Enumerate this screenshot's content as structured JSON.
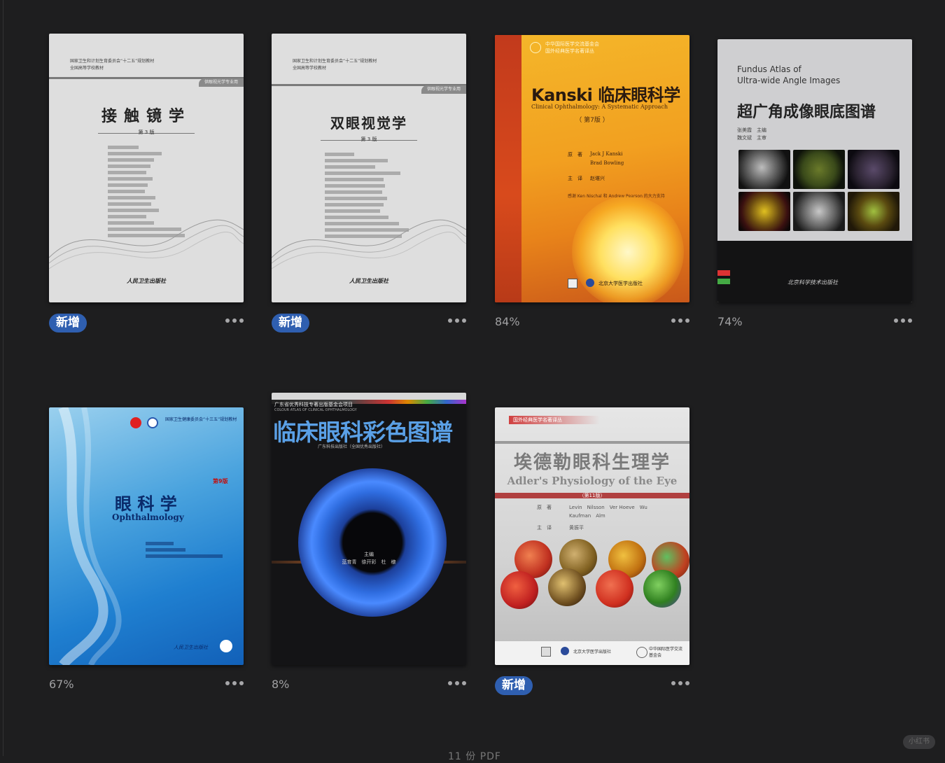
{
  "books": [
    {
      "id": "b1",
      "status_badge": "新增",
      "progress": "",
      "cover": {
        "title": "接触镜学",
        "edition": "第 3 版",
        "series": "供眼视光学专业用",
        "publisher": "人民卫生出版社",
        "header1": "国家卫生和计划生育委员会“十二五”规划教材",
        "header2": "全国高等学校教材"
      }
    },
    {
      "id": "b2",
      "status_badge": "新增",
      "progress": "",
      "cover": {
        "title": "双眼视觉学",
        "edition": "第 3 版",
        "series": "供眼视光学专业用",
        "publisher": "人民卫生出版社",
        "header1": "国家卫生和计划生育委员会“十二五”规划教材",
        "header2": "全国高等学校教材"
      }
    },
    {
      "id": "b3",
      "status_badge": "",
      "progress": "84%",
      "cover": {
        "top_line1": "中华国际医学交流基金会",
        "top_line2": "国外经典医学名著译丛",
        "title": "Kanski 临床眼科学",
        "subtitle": "Clinical Ophthalmology: A Systematic Approach",
        "edition": "（ 第7版 ）",
        "author_label": "原　著",
        "authors1": "Jack J Kanski",
        "authors2": "Brad Bowling",
        "translator_label": "主　译",
        "translator": "赵堪兴",
        "thanks": "感谢 Ken Nischal 和 Andrew Pearson 的大力支持",
        "publisher": "北京大学医学出版社"
      }
    },
    {
      "id": "b4",
      "status_badge": "",
      "progress": "74%",
      "cover": {
        "en_title1": "Fundus Atlas of",
        "en_title2": "Ultra-wide Angle Images",
        "title": "超广角成像眼底图谱",
        "editor1": "张美霞　主编",
        "editor2": "魏文斌　主审",
        "publisher": "北京科学技术出版社"
      }
    },
    {
      "id": "b5",
      "status_badge": "",
      "progress": "67%",
      "cover": {
        "title": "眼 科 学",
        "en_title": "Ophthalmology",
        "edition": "第9版",
        "header": "国家卫生健康委员会“十三五”规划教材",
        "publisher": "人民卫生出版社"
      }
    },
    {
      "id": "b6",
      "status_badge": "",
      "progress": "8%",
      "cover": {
        "top_line": "广东省优秀科技专著出版基金会项目",
        "en_line": "COLOUR ATLAS OF CLINICAL OPHTHALMOLOGY",
        "title": "临床眼科彩色图谱",
        "sub_line": "广东科技出版社（全国优秀出版社）",
        "center_label": "主编",
        "center_names": "蓝育青　徐开彩　杜　棣"
      }
    },
    {
      "id": "b7",
      "status_badge": "新增",
      "progress": "",
      "cover": {
        "top_line": "国外经典医学名著译丛",
        "title": "埃德勒眼科生理学",
        "en_title": "Adler's Physiology of the Eye",
        "edition": "（第11版）",
        "author_label": "原　著",
        "authors1": "Levin　Nilsson　Ver Hoeve　Wu",
        "authors2": "Kaufman　Alm",
        "translator_label": "主　译",
        "translator": "黄振平",
        "publisher1": "北京大学医学出版社",
        "publisher2": "中华国际医学交流基金会"
      }
    }
  ],
  "more_label": "更多",
  "watermark": "小红书",
  "bottom_peek": "11 份 PDF"
}
